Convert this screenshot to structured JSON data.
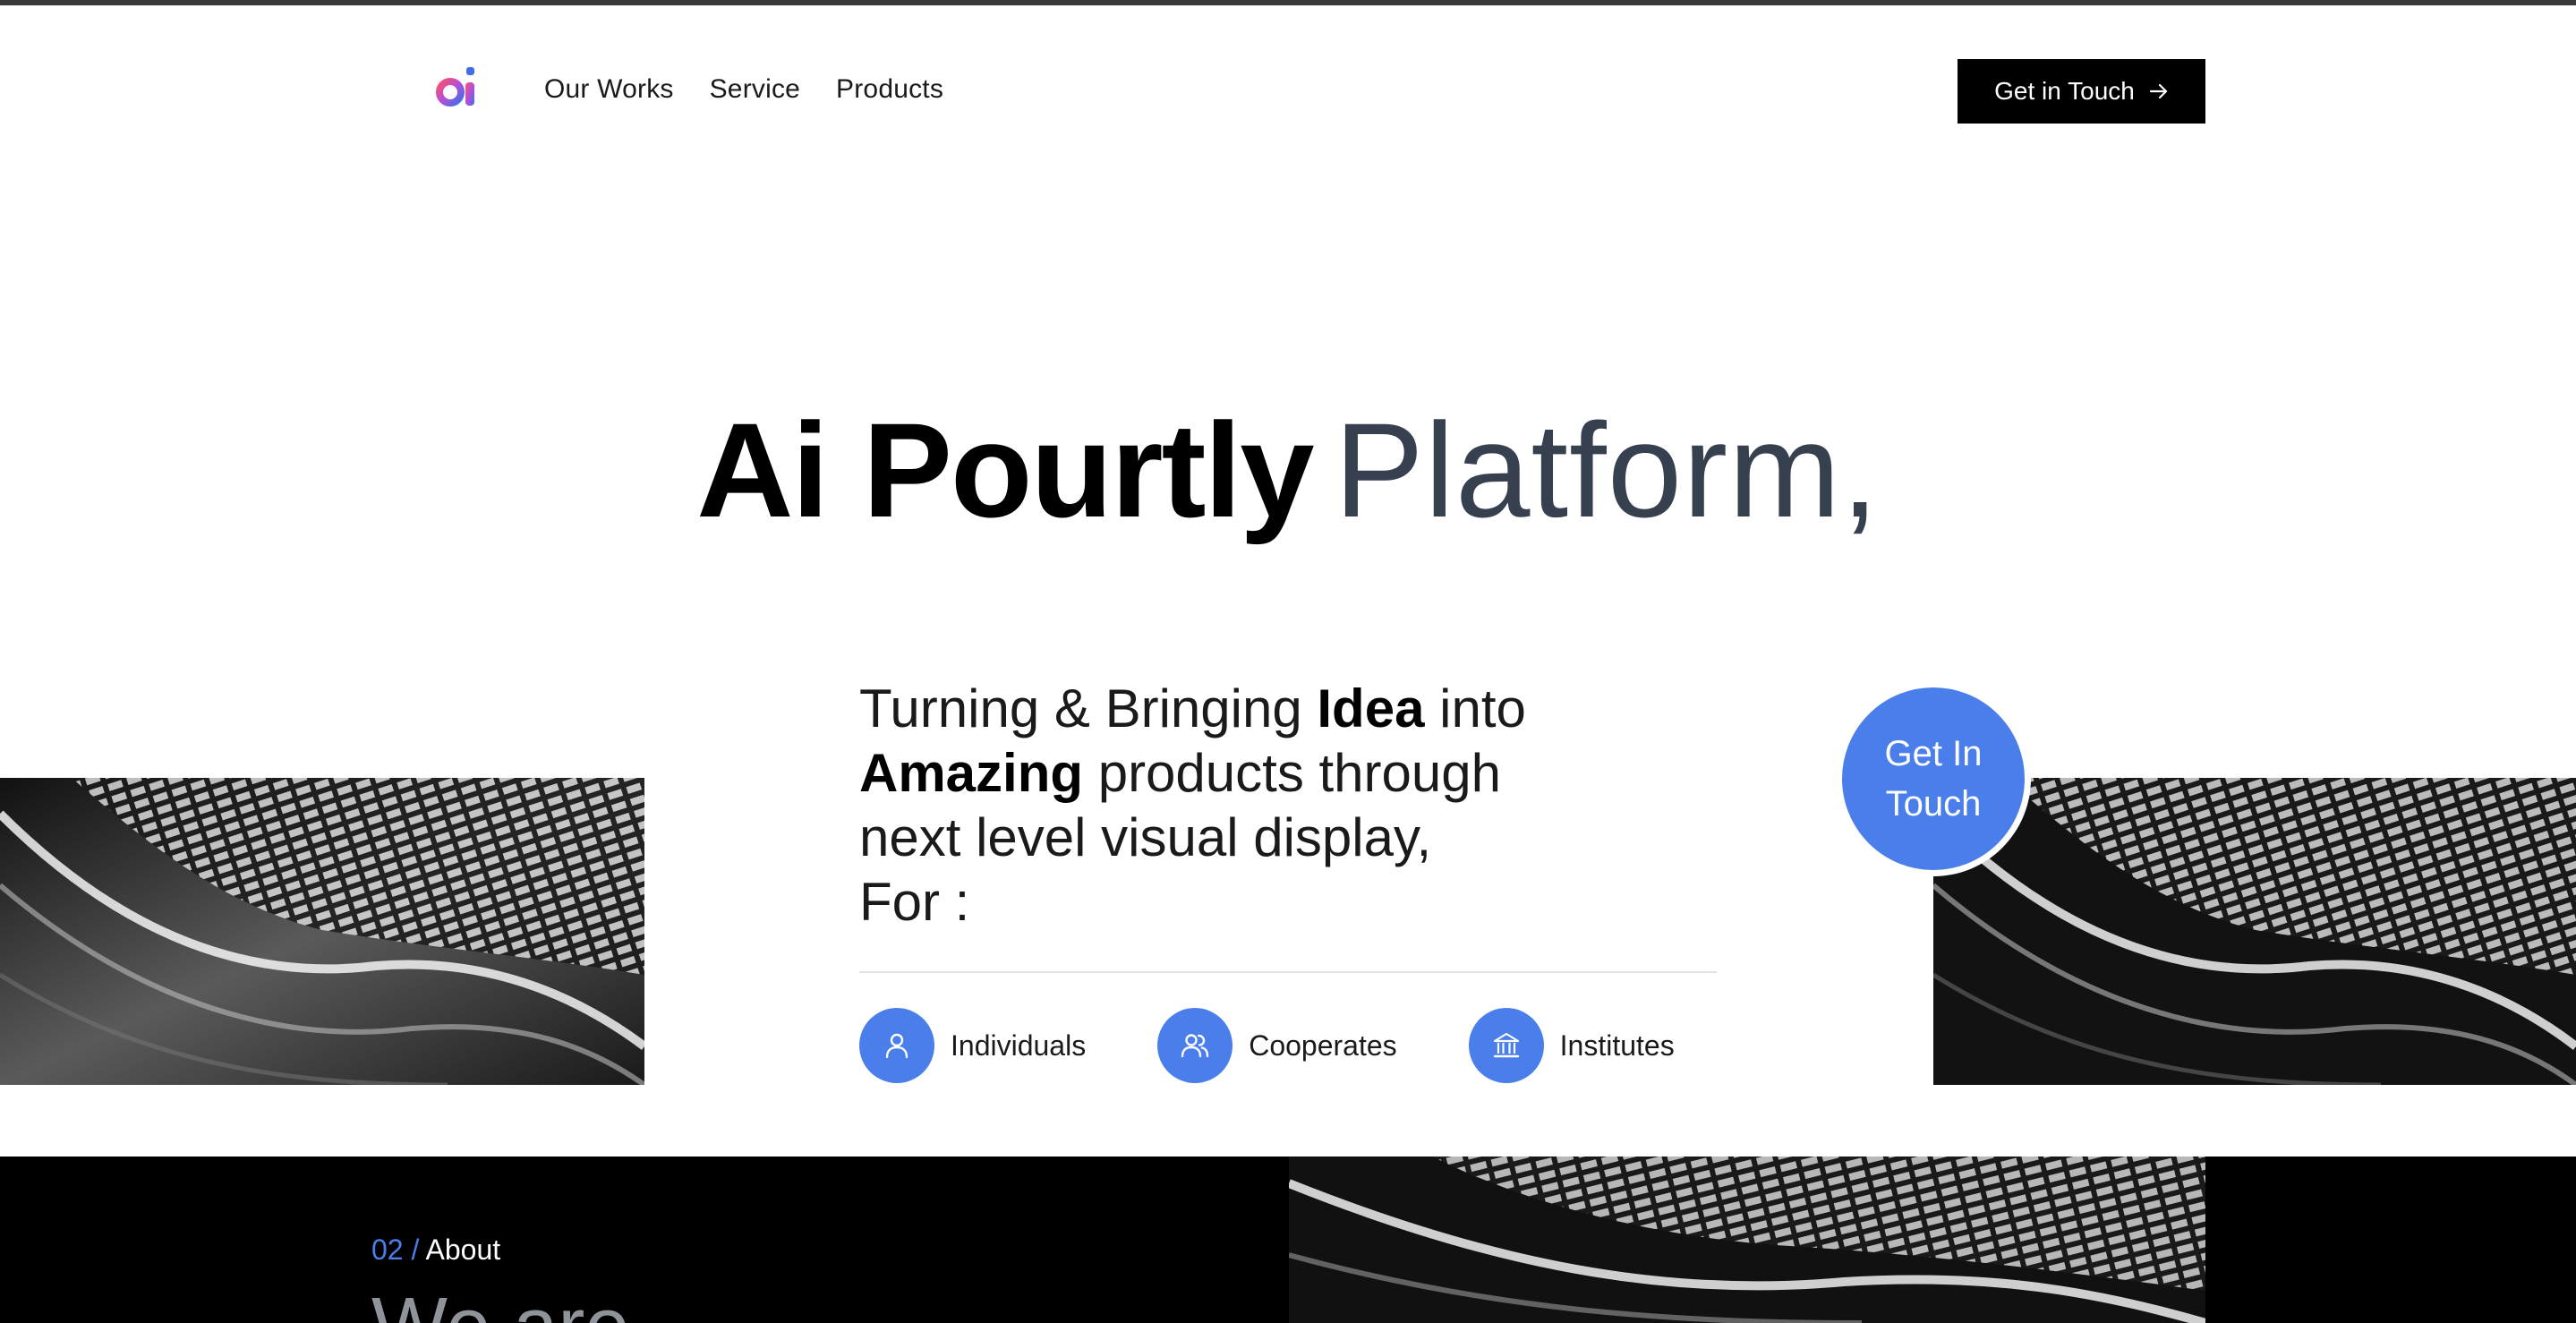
{
  "header": {
    "logo_text": "ai",
    "nav": [
      "Our Works",
      "Service",
      "Products"
    ],
    "cta_label": "Get in Touch"
  },
  "hero": {
    "title_bold": "Ai Pourtly",
    "title_light": "Platform,",
    "tagline": {
      "l1_a": "Turning & Bringing ",
      "l1_b": "Idea",
      "l1_c": " into",
      "l2_a": "Amazing",
      "l2_b": " products through",
      "l3": "next level visual display,",
      "l4": "For :"
    },
    "audiences": [
      {
        "label": "Individuals",
        "icon": "user-icon"
      },
      {
        "label": "Cooperates",
        "icon": "users-icon"
      },
      {
        "label": "Institutes",
        "icon": "bank-icon"
      }
    ],
    "circle_cta": {
      "line1": "Get In",
      "line2": "Touch"
    }
  },
  "about": {
    "num": "02 /",
    "label": "About",
    "heading": "We are"
  },
  "colors": {
    "accent": "#4a7eea",
    "dark": "#000000",
    "title_light": "#36404f"
  }
}
